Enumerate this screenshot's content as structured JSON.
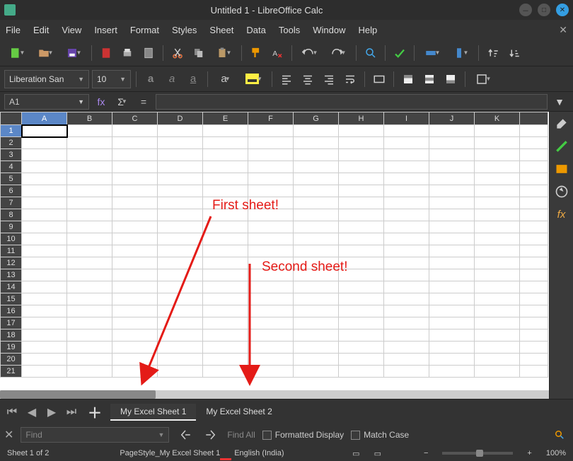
{
  "title": "Untitled 1 - LibreOffice Calc",
  "menu": [
    "File",
    "Edit",
    "View",
    "Insert",
    "Format",
    "Styles",
    "Sheet",
    "Data",
    "Tools",
    "Window",
    "Help"
  ],
  "font": {
    "name": "Liberation San",
    "size": "10"
  },
  "cellRef": "A1",
  "columns": [
    "A",
    "B",
    "C",
    "D",
    "E",
    "F",
    "G",
    "H",
    "I",
    "J",
    "K"
  ],
  "rowCount": 21,
  "selectedCell": {
    "row": 1,
    "col": "A"
  },
  "sheetTabs": [
    {
      "label": "My Excel Sheet 1",
      "active": true
    },
    {
      "label": "My Excel Sheet 2",
      "active": false
    }
  ],
  "find": {
    "placeholder": "Find",
    "findAll": "Find All",
    "formatted": "Formatted Display",
    "matchCase": "Match Case"
  },
  "status": {
    "sheet": "Sheet 1 of 2",
    "pageStyle": "PageStyle_My Excel Sheet 1",
    "lang": "English (India)",
    "zoom": "100%"
  },
  "annotations": {
    "first": "First sheet!",
    "second": "Second sheet!"
  }
}
